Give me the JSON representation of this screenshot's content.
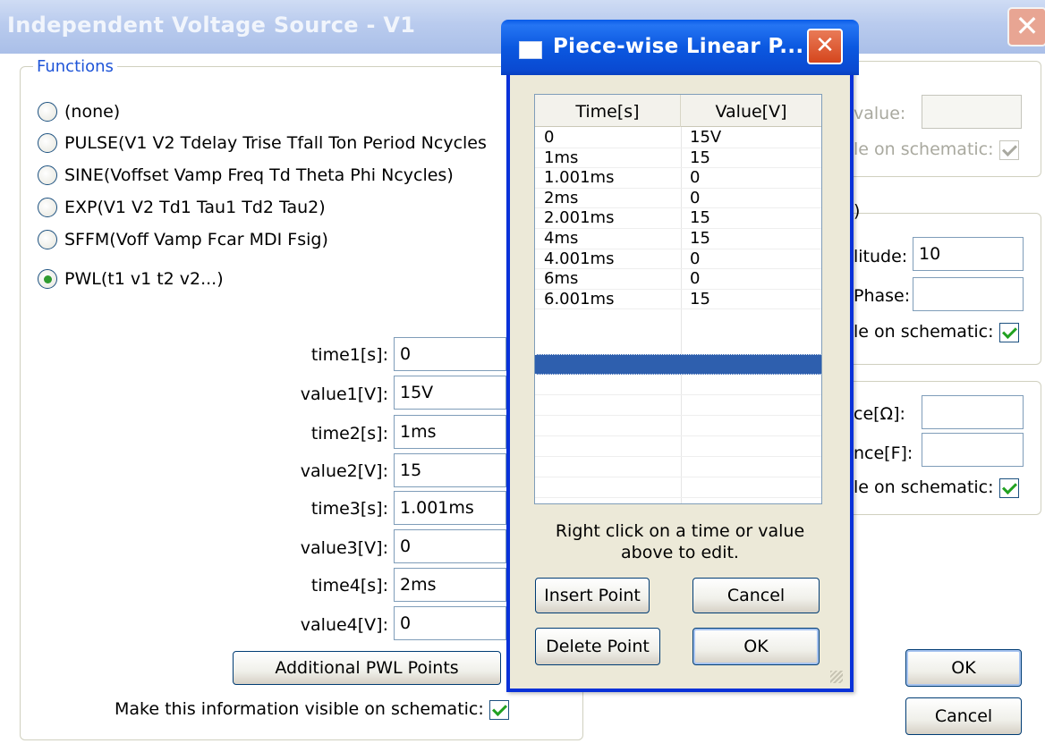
{
  "parent": {
    "title": "Independent Voltage Source - V1",
    "close_glyph": "✕",
    "functions_legend": "Functions",
    "radio_options": [
      {
        "label": "(none)",
        "checked": false
      },
      {
        "label": "PULSE(V1 V2 Tdelay Trise Tfall Ton Period Ncycles",
        "checked": false
      },
      {
        "label": "SINE(Voffset Vamp Freq Td Theta Phi Ncycles)",
        "checked": false
      },
      {
        "label": "EXP(V1 V2 Td1 Tau1 Td2 Tau2)",
        "checked": false
      },
      {
        "label": "SFFM(Voff Vamp Fcar MDI Fsig)",
        "checked": false
      },
      {
        "label": "PWL(t1 v1 t2 v2...)",
        "checked": true
      }
    ],
    "pwl_fields": [
      {
        "label": "time1[s]:",
        "value": "0"
      },
      {
        "label": "value1[V]:",
        "value": "15V"
      },
      {
        "label": "time2[s]:",
        "value": "1ms"
      },
      {
        "label": "value2[V]:",
        "value": "15"
      },
      {
        "label": "time3[s]:",
        "value": "1.001ms"
      },
      {
        "label": "value3[V]:",
        "value": "0"
      },
      {
        "label": "time4[s]:",
        "value": "2ms"
      },
      {
        "label": "value4[V]:",
        "value": "0"
      }
    ],
    "additional_pwl_button": "Additional PWL Points",
    "visible_on_schematic_label": "Make this information visible on schematic:",
    "right_partial": {
      "dc_value_label": "value:",
      "dc_visible_label": "le on schematic:",
      "ac_paren": ")",
      "amplitude_label": "litude:",
      "amplitude_value": "10",
      "phase_label": "Phase:",
      "ac_visible_label": "le on schematic:",
      "resistance_label": "ce[Ω]:",
      "capacitance_label": "nce[F]:",
      "par_visible_label": "le on schematic:"
    },
    "ok_button": "OK",
    "cancel_button": "Cancel"
  },
  "child": {
    "title": "Piece-wise Linear P...",
    "close_glyph": "✕",
    "table": {
      "headers": [
        "Time[s]",
        "Value[V]"
      ],
      "rows": [
        [
          "0",
          "15V"
        ],
        [
          "1ms",
          "15"
        ],
        [
          "1.001ms",
          "0"
        ],
        [
          "2ms",
          "0"
        ],
        [
          "2.001ms",
          "15"
        ],
        [
          "4ms",
          "15"
        ],
        [
          "4.001ms",
          "0"
        ],
        [
          "6ms",
          "0"
        ],
        [
          "6.001ms",
          "15"
        ]
      ]
    },
    "hint_line1": "Right click on a time or value",
    "hint_line2": "above to edit.",
    "insert_button": "Insert Point",
    "cancel_button": "Cancel",
    "delete_button": "Delete Point",
    "ok_button": "OK"
  },
  "colors": {
    "xp_blue": "#0a5ce8",
    "legend_blue": "#1f55d8",
    "selection": "#2e5fae",
    "dialog_face": "#ece9d8"
  }
}
